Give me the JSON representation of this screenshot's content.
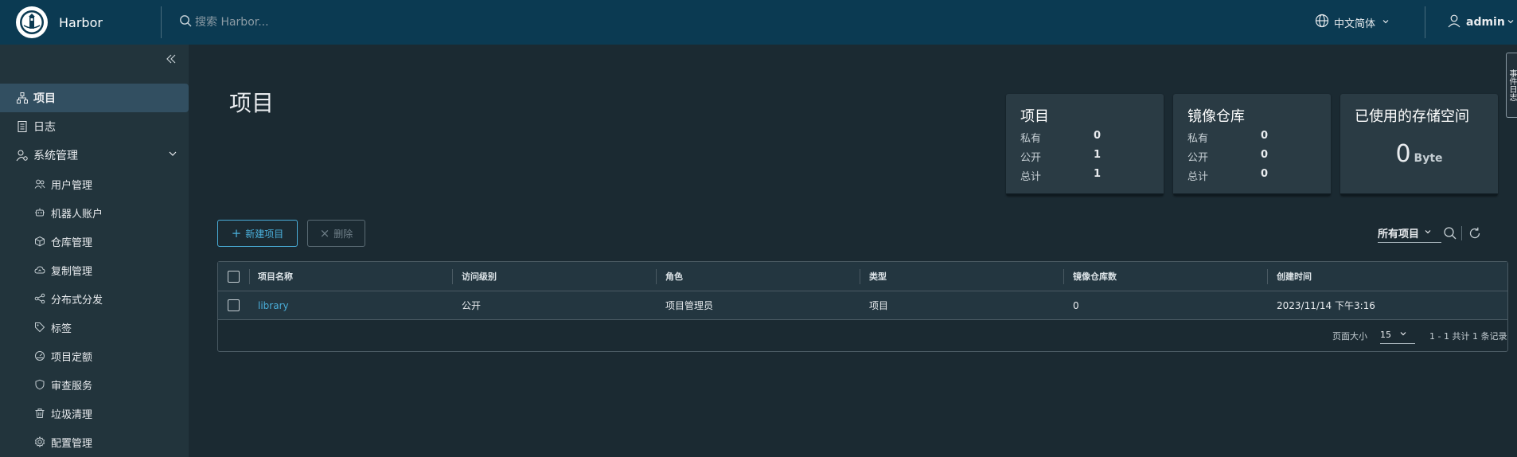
{
  "header": {
    "app_title": "Harbor",
    "search_placeholder": "搜索 Harbor...",
    "language": "中文简体",
    "user": "admin"
  },
  "sidebar": {
    "items": [
      {
        "label": "项目",
        "icon": "projects-icon",
        "active": true
      },
      {
        "label": "日志",
        "icon": "log-icon"
      },
      {
        "label": "系统管理",
        "icon": "admin-icon",
        "expanded": true
      }
    ],
    "sub_items": [
      {
        "label": "用户管理",
        "icon": "users-icon"
      },
      {
        "label": "机器人账户",
        "icon": "robot-icon"
      },
      {
        "label": "仓库管理",
        "icon": "registry-icon"
      },
      {
        "label": "复制管理",
        "icon": "cloud-replication-icon"
      },
      {
        "label": "分布式分发",
        "icon": "share-icon"
      },
      {
        "label": "标签",
        "icon": "tag-icon"
      },
      {
        "label": "项目定额",
        "icon": "quota-icon"
      },
      {
        "label": "审查服务",
        "icon": "shield-icon"
      },
      {
        "label": "垃圾清理",
        "icon": "trash-icon"
      },
      {
        "label": "配置管理",
        "icon": "gear-icon"
      }
    ]
  },
  "main": {
    "title": "项目",
    "cards": {
      "projects": {
        "title": "项目",
        "rows": [
          {
            "label": "私有",
            "value": "0"
          },
          {
            "label": "公开",
            "value": "1"
          },
          {
            "label": "总计",
            "value": "1"
          }
        ]
      },
      "repos": {
        "title": "镜像仓库",
        "rows": [
          {
            "label": "私有",
            "value": "0"
          },
          {
            "label": "公开",
            "value": "0"
          },
          {
            "label": "总计",
            "value": "0"
          }
        ]
      },
      "storage": {
        "title": "已使用的存储空间",
        "value": "0",
        "unit": "Byte"
      }
    },
    "actions": {
      "new_project": "新建项目",
      "delete": "删除"
    },
    "filter": {
      "selected": "所有项目"
    },
    "table": {
      "headers": [
        "项目名称",
        "访问级别",
        "角色",
        "类型",
        "镜像仓库数",
        "创建时间"
      ],
      "rows": [
        {
          "name": "library",
          "access": "公开",
          "role": "项目管理员",
          "type": "项目",
          "repo_count": "0",
          "created": "2023/11/14 下午3:16"
        }
      ],
      "footer": {
        "page_size_label": "页面大小",
        "page_size": "15",
        "total": "1 - 1 共计 1 条记录"
      }
    },
    "side_tab": "事件日志"
  }
}
